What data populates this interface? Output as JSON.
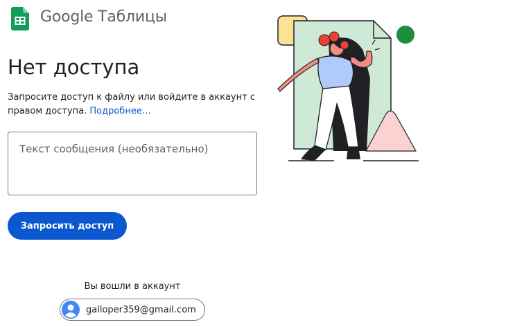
{
  "header": {
    "logo_icon": "google-sheets-icon",
    "brand": "Google Таблицы"
  },
  "main": {
    "title": "Нет доступа",
    "description": "Запросите доступ к файлу или войдите в аккаунт с правом доступа.",
    "learn_more": "Подробнее…",
    "message_placeholder": "Текст сообщения (необязательно)",
    "request_button": "Запросить доступ"
  },
  "account": {
    "signed_in_label": "Вы вошли в аккаунт",
    "email": "galloper359@gmail.com",
    "avatar_icon": "account-circle-icon"
  },
  "colors": {
    "primary": "#0b57d0",
    "sheets_green": "#0f9d58",
    "illustration_green": "#ceead6",
    "illustration_pink": "#fad2cf",
    "illustration_yellow": "#fde293",
    "illustration_red": "#ea4335",
    "illustration_blue": "#aecbfa",
    "illustration_dot": "#1e8e3e"
  }
}
